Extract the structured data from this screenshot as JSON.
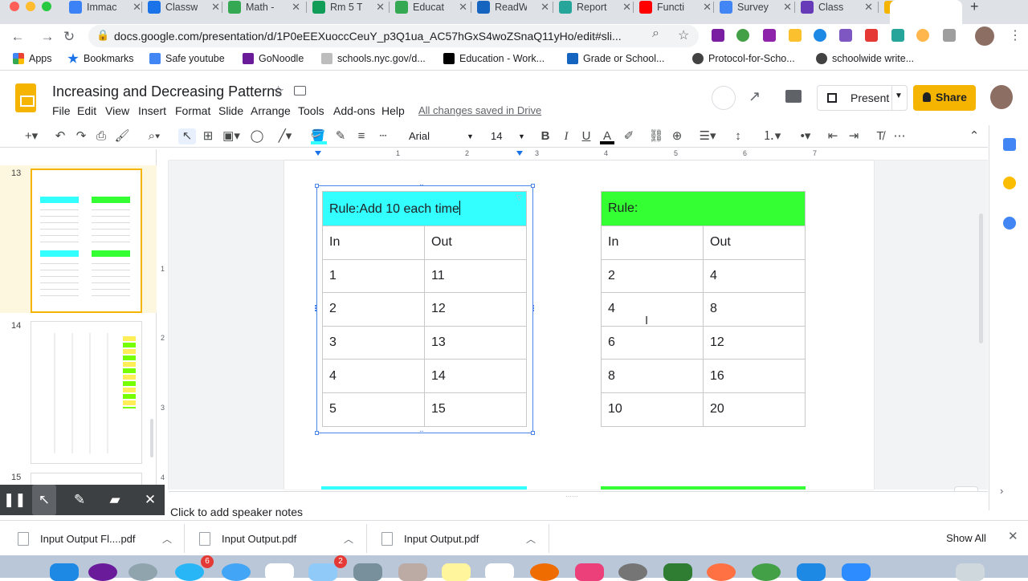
{
  "browser": {
    "tabs": [
      {
        "label": "Immac",
        "color": "#3b82f6"
      },
      {
        "label": "Classw",
        "color": "#1a73e8"
      },
      {
        "label": "Math -",
        "color": "#34a853"
      },
      {
        "label": "Rm 5 T",
        "color": "#0f9d58"
      },
      {
        "label": "Educat",
        "color": "#34a853"
      },
      {
        "label": "ReadW",
        "color": "#1565c0"
      },
      {
        "label": "Report",
        "color": "#26a69a"
      },
      {
        "label": "Functi",
        "color": "#ff0000"
      },
      {
        "label": "Survey",
        "color": "#4285f4"
      },
      {
        "label": "Class",
        "color": "#673ab7"
      },
      {
        "label": "Increa",
        "color": "#f4b400"
      }
    ],
    "new_tab": "+",
    "url": "docs.google.com/presentation/d/1P0eEEXuoccCeuY_p3Q1ua_AC57hGxS4woZSnaQ11yHo/edit#sli...",
    "bookmarks": [
      {
        "label": "Apps",
        "color": "#ea4335"
      },
      {
        "label": "Bookmarks",
        "color": "#1a73e8"
      },
      {
        "label": "Safe youtube",
        "color": "#4285f4"
      },
      {
        "label": "GoNoodle",
        "color": "#6a1b9a"
      },
      {
        "label": "schools.nyc.gov/d...",
        "color": "#bdbdbd"
      },
      {
        "label": "Education - Work...",
        "color": "#000000"
      },
      {
        "label": "Grade or School...",
        "color": "#1565c0"
      },
      {
        "label": "Protocol-for-Scho...",
        "color": "#424242"
      },
      {
        "label": "schoolwide write...",
        "color": "#424242"
      }
    ]
  },
  "slides": {
    "title": "Increasing and Decreasing Patterns",
    "menu": [
      "File",
      "Edit",
      "View",
      "Insert",
      "Format",
      "Slide",
      "Arrange",
      "Tools",
      "Add-ons",
      "Help"
    ],
    "saved_status": "All changes saved in Drive",
    "present_label": "Present",
    "share_label": "Share",
    "font_name": "Arial",
    "font_size": "14",
    "ruler_numbers": [
      "1",
      "2",
      "3",
      "4",
      "5",
      "6",
      "7"
    ],
    "vruler_numbers": [
      "1",
      "2",
      "3",
      "4"
    ],
    "slide_numbers": [
      "13",
      "14",
      "15"
    ],
    "speaker_notes_placeholder": "Click to add speaker notes"
  },
  "table_left": {
    "rule": "Rule:Add 10 each time",
    "in_header": "In",
    "out_header": "Out",
    "rows": [
      [
        "1",
        "11"
      ],
      [
        "2",
        "12"
      ],
      [
        "3",
        "13"
      ],
      [
        "4",
        "14"
      ],
      [
        "5",
        "15"
      ]
    ],
    "header_color": "#33ffff"
  },
  "table_right": {
    "rule": "Rule:",
    "in_header": "In",
    "out_header": "Out",
    "rows": [
      [
        "2",
        "4"
      ],
      [
        "4",
        "8"
      ],
      [
        "6",
        "12"
      ],
      [
        "8",
        "16"
      ],
      [
        "10",
        "20"
      ]
    ],
    "header_color": "#33ff33"
  },
  "downloads": [
    {
      "label": "Input Output Fl....pdf"
    },
    {
      "label": "Input Output.pdf"
    },
    {
      "label": "Input Output.pdf"
    }
  ],
  "downloads_show_all": "Show All",
  "dock_badges": [
    "6",
    "2"
  ]
}
